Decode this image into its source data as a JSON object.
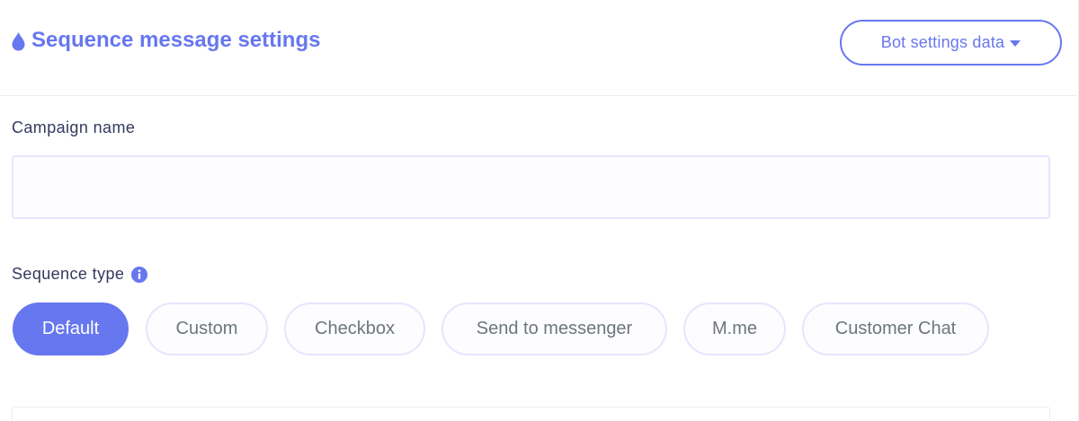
{
  "header": {
    "title": "Sequence message settings",
    "title_icon": "droplet-icon",
    "dropdown_label": "Bot settings data"
  },
  "form": {
    "campaign_label": "Campaign name",
    "campaign_value": "",
    "sequence_type_label": "Sequence type",
    "sequence_type_info_icon": "info-circle-icon",
    "sequence_types": [
      {
        "label": "Default",
        "active": true
      },
      {
        "label": "Custom",
        "active": false
      },
      {
        "label": "Checkbox",
        "active": false
      },
      {
        "label": "Send to messenger",
        "active": false
      },
      {
        "label": "M.me",
        "active": false
      },
      {
        "label": "Customer Chat",
        "active": false
      }
    ]
  },
  "colors": {
    "primary": "#6777ef",
    "label": "#34395e",
    "muted": "#6c757d",
    "border": "#e4e6fc"
  }
}
